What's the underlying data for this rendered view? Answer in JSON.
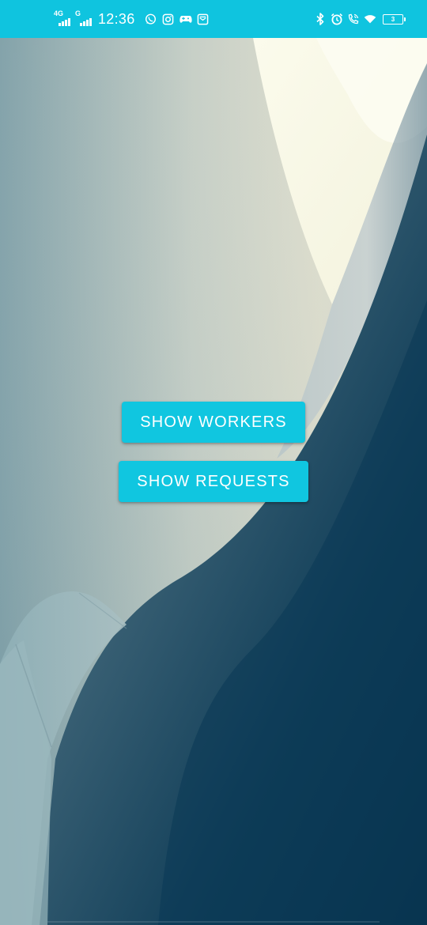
{
  "status_bar": {
    "network_type_1": "4G",
    "network_type_2": "G",
    "time": "12:36",
    "app_icons": [
      "whatsapp-icon",
      "instagram-icon",
      "gamepad-icon",
      "mail-icon"
    ],
    "system_icons": [
      "bluetooth-icon",
      "alarm-icon",
      "wifi-calling-icon",
      "wifi-icon"
    ],
    "battery_level": "3",
    "background_color": "#0fc4df"
  },
  "main": {
    "show_workers_label": "SHOW WORKERS",
    "show_requests_label": "SHOW REQUESTS",
    "button_color": "#10c6e0"
  }
}
